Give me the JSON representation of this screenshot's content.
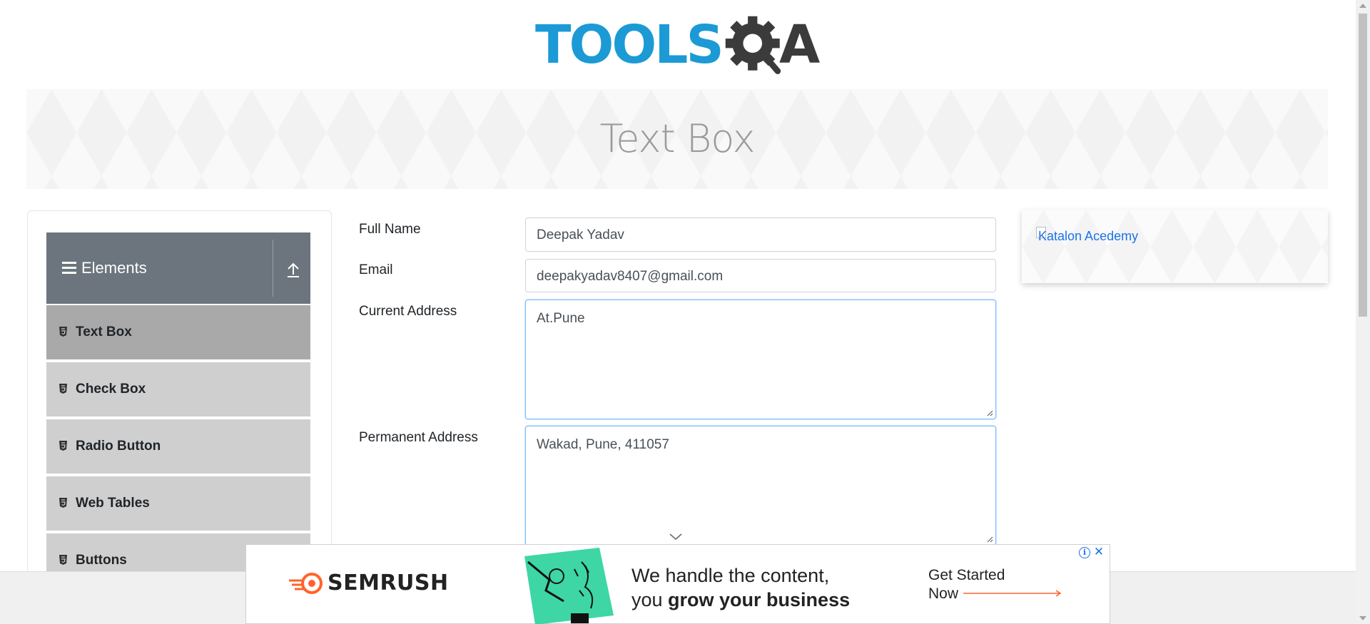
{
  "header": {
    "logo_text_main": "TOOLS",
    "logo_text_end": "A",
    "logo_color_main": "#1b9ad6",
    "logo_color_dark": "#3b3b3b"
  },
  "banner": {
    "title": "Text Box"
  },
  "sidebar": {
    "group_title": "Elements",
    "group_icon": "hamburger-icon",
    "collapse_icon": "arrow-up-icon",
    "items": [
      {
        "label": "Text Box",
        "icon": "html5-icon",
        "active": true
      },
      {
        "label": "Check Box",
        "icon": "html5-icon",
        "active": false
      },
      {
        "label": "Radio Button",
        "icon": "html5-icon",
        "active": false
      },
      {
        "label": "Web Tables",
        "icon": "html5-icon",
        "active": false
      },
      {
        "label": "Buttons",
        "icon": "html5-icon",
        "active": false
      }
    ]
  },
  "form": {
    "full_name": {
      "label": "Full Name",
      "value": "Deepak Yadav"
    },
    "email": {
      "label": "Email",
      "value": "deepakyadav8407@gmail.com"
    },
    "current_address": {
      "label": "Current Address",
      "value": "At.Pune"
    },
    "permanent_address": {
      "label": "Permanent Address",
      "value": "Wakad, Pune, 411057"
    }
  },
  "right_ad": {
    "alt_text": "Katalon Acedemy"
  },
  "bottom_ad": {
    "brand": "SEMRUSH",
    "line1": "We handle the content,",
    "line2_prefix": "you ",
    "line2_bold": "grow your business",
    "cta_line1": "Get Started",
    "cta_line2": "Now",
    "info_icon": "info-icon",
    "close_icon": "close-icon",
    "accent_color": "#ff642d"
  }
}
